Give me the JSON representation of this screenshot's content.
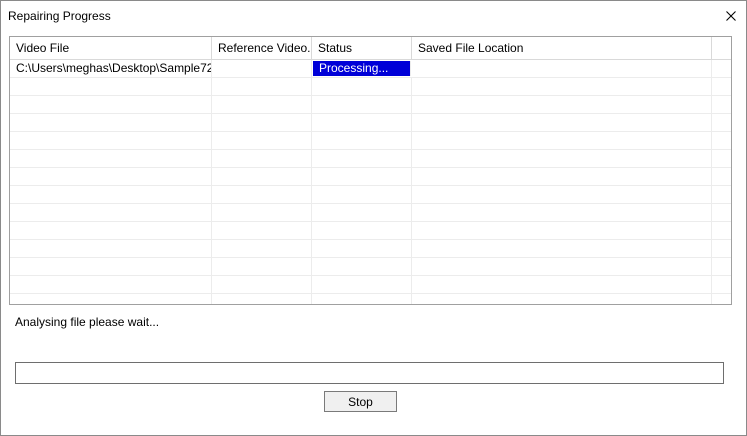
{
  "window": {
    "title": "Repairing Progress",
    "close_icon": "close-icon"
  },
  "grid": {
    "columns": [
      "Video File",
      "Reference Video...",
      "Status",
      "Saved File Location",
      ""
    ],
    "rows": [
      [
        "C:\\Users\\meghas\\Desktop\\Sample72...",
        "",
        "Processing...",
        "",
        ""
      ]
    ],
    "empty_row_count": 14,
    "selected_color": "#0000d8"
  },
  "status_message": "Analysing file please wait...",
  "progress": {
    "value_percent": 0
  },
  "stop_button": {
    "label": "Stop"
  }
}
